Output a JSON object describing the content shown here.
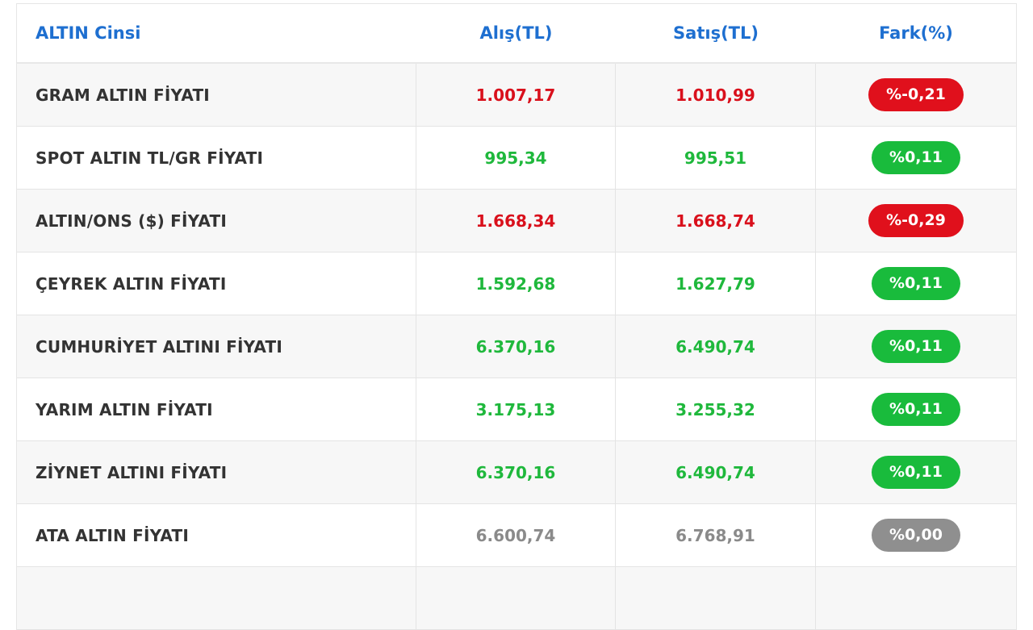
{
  "header": {
    "col_name": "ALTIN Cinsi",
    "col_buy": "Alış(TL)",
    "col_sell": "Satış(TL)",
    "col_diff": "Fark(%)"
  },
  "rows": [
    {
      "name": "GRAM ALTIN FİYATI",
      "buy": "1.007,17",
      "sell": "1.010,99",
      "diff": "%-0,21",
      "trend": "down"
    },
    {
      "name": "SPOT ALTIN TL/GR FİYATI",
      "buy": "995,34",
      "sell": "995,51",
      "diff": "%0,11",
      "trend": "up"
    },
    {
      "name": "ALTIN/ONS ($) FİYATI",
      "buy": "1.668,34",
      "sell": "1.668,74",
      "diff": "%-0,29",
      "trend": "down"
    },
    {
      "name": "ÇEYREK ALTIN FİYATI",
      "buy": "1.592,68",
      "sell": "1.627,79",
      "diff": "%0,11",
      "trend": "up"
    },
    {
      "name": "CUMHURİYET ALTINI FİYATI",
      "buy": "6.370,16",
      "sell": "6.490,74",
      "diff": "%0,11",
      "trend": "up"
    },
    {
      "name": "YARIM ALTIN FİYATI",
      "buy": "3.175,13",
      "sell": "3.255,32",
      "diff": "%0,11",
      "trend": "up"
    },
    {
      "name": "ZİYNET ALTINI FİYATI",
      "buy": "6.370,16",
      "sell": "6.490,74",
      "diff": "%0,11",
      "trend": "up"
    },
    {
      "name": "ATA ALTIN FİYATI",
      "buy": "6.600,74",
      "sell": "6.768,91",
      "diff": "%0,00",
      "trend": "flat"
    }
  ],
  "colors": {
    "header_text": "#1e6fd0",
    "down": "#d9101c",
    "up": "#1fb83c",
    "flat": "#8a8a8a"
  }
}
